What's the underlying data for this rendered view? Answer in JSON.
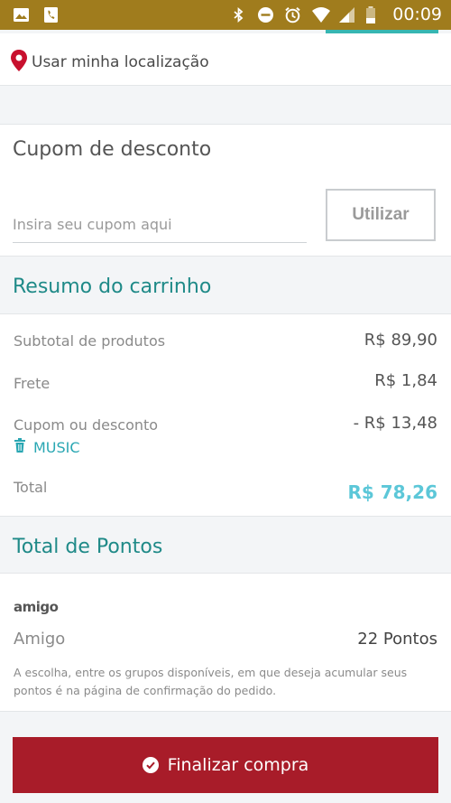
{
  "statusbar": {
    "time": "00:09"
  },
  "location": {
    "label": "Usar minha localização"
  },
  "coupon": {
    "title": "Cupom de desconto",
    "placeholder": "Insira seu cupom aqui",
    "button_label": "Utilizar"
  },
  "cart_summary": {
    "title": "Resumo do carrinho",
    "rows": [
      {
        "label": "Subtotal de produtos",
        "value": "R$ 89,90"
      },
      {
        "label": "Frete",
        "value": "R$ 1,84"
      },
      {
        "label": "Cupom ou desconto",
        "value": "- R$ 13,48"
      }
    ],
    "coupon_code": "MUSIC",
    "total_label": "Total",
    "total_value": "R$ 78,26"
  },
  "points": {
    "title": "Total de Pontos",
    "logo_text": "amigo",
    "program_name": "Amigo",
    "points_value": "22 Pontos",
    "note": "A escolha, entre os grupos disponíveis, em que deseja acumular seus pontos é na página de confirmação do pedido."
  },
  "finalize": {
    "label": "Finalizar compra"
  },
  "colors": {
    "status_bar": "#a07c1d",
    "teal": "#1f8a88",
    "accent_cyan": "#5cc7d8",
    "primary_button": "#a81c29"
  }
}
